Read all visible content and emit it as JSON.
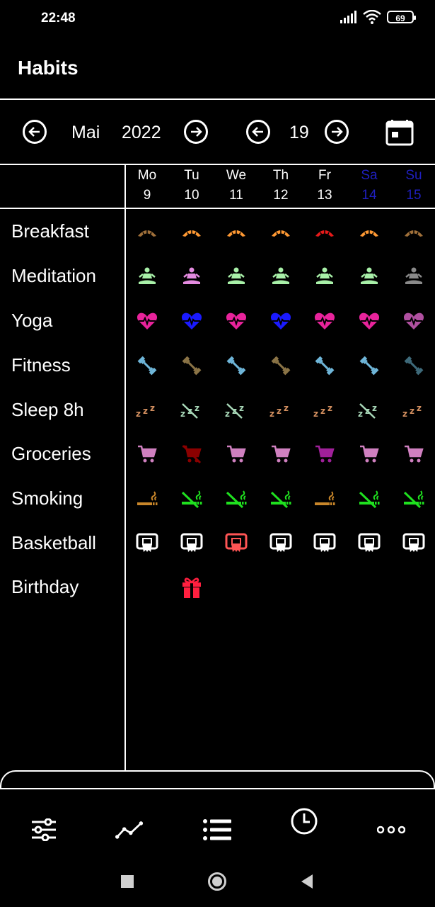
{
  "status_bar": {
    "time": "22:48",
    "battery": "69"
  },
  "app": {
    "title": "Habits"
  },
  "month_nav": {
    "month": "Mai",
    "year": "2022",
    "week": "19"
  },
  "days": [
    {
      "name": "Mo",
      "num": "9",
      "weekend": false
    },
    {
      "name": "Tu",
      "num": "10",
      "weekend": false
    },
    {
      "name": "We",
      "num": "11",
      "weekend": false
    },
    {
      "name": "Th",
      "num": "12",
      "weekend": false
    },
    {
      "name": "Fr",
      "num": "13",
      "weekend": false
    },
    {
      "name": "Sa",
      "num": "14",
      "weekend": true
    },
    {
      "name": "Su",
      "num": "15",
      "weekend": true
    }
  ],
  "habits": [
    {
      "label": "Breakfast",
      "icon": "croissant-icon",
      "cells": [
        "#a0703a",
        "#ff9933",
        "#ff9933",
        "#ff9933",
        "#e61a1a",
        "#ff9933",
        "#a0703a"
      ]
    },
    {
      "label": "Meditation",
      "icon": "meditation-icon",
      "cells": [
        "#a8f0a8",
        "#e48be0",
        "#a8f0a8",
        "#a8f0a8",
        "#a8f0a8",
        "#a8f0a8",
        "#8a8a8a"
      ]
    },
    {
      "label": "Yoga",
      "icon": "heart-pulse-icon",
      "cells": [
        "#e8239b",
        "#1a1aff",
        "#e8239b",
        "#1a1aff",
        "#e8239b",
        "#e8239b",
        "#b050a0"
      ]
    },
    {
      "label": "Fitness",
      "icon": "dumbbell-icon",
      "cells": [
        "#6fb6d9",
        "#8b7446",
        "#6fb6d9",
        "#8b7446",
        "#6fb6d9",
        "#6fb6d9",
        "#3e6a7a"
      ]
    },
    {
      "label": "Sleep 8h",
      "icon": "sleep-zzz-icon",
      "cells": [
        "#d49060",
        "#a8d8b8",
        "#a8d8b8",
        "#d49060",
        "#d49060",
        "#a8d8b8",
        "#d49060"
      ]
    },
    {
      "label": "Groceries",
      "icon": "cart-icon",
      "cells": [
        "#d080c0",
        "#8b0000",
        "#d080c0",
        "#d080c0",
        "#a0209a",
        "#d080c0",
        "#d080c0"
      ]
    },
    {
      "label": "Smoking",
      "icon": "cigarette-icon",
      "cells": [
        "#c8862a",
        "#1fe01f",
        "#1fe01f",
        "#1fe01f",
        "#c8862a",
        "#1fe01f",
        "#1fe01f"
      ]
    },
    {
      "label": "Basketball",
      "icon": "basketball-hoop-icon",
      "cells": [
        "#ffffff",
        "#ffffff",
        "#ff5555",
        "#ffffff",
        "#ffffff",
        "#ffffff",
        "#ffffff"
      ]
    },
    {
      "label": "Birthday",
      "icon": "gift-icon",
      "cells": [
        "",
        "#ff1f3f",
        "",
        "",
        "",
        "",
        ""
      ]
    }
  ],
  "bottom_nav": [
    {
      "icon": "sliders-icon"
    },
    {
      "icon": "chart-line-icon"
    },
    {
      "icon": "list-icon"
    },
    {
      "icon": "clock-icon"
    },
    {
      "icon": "more-icon"
    }
  ]
}
